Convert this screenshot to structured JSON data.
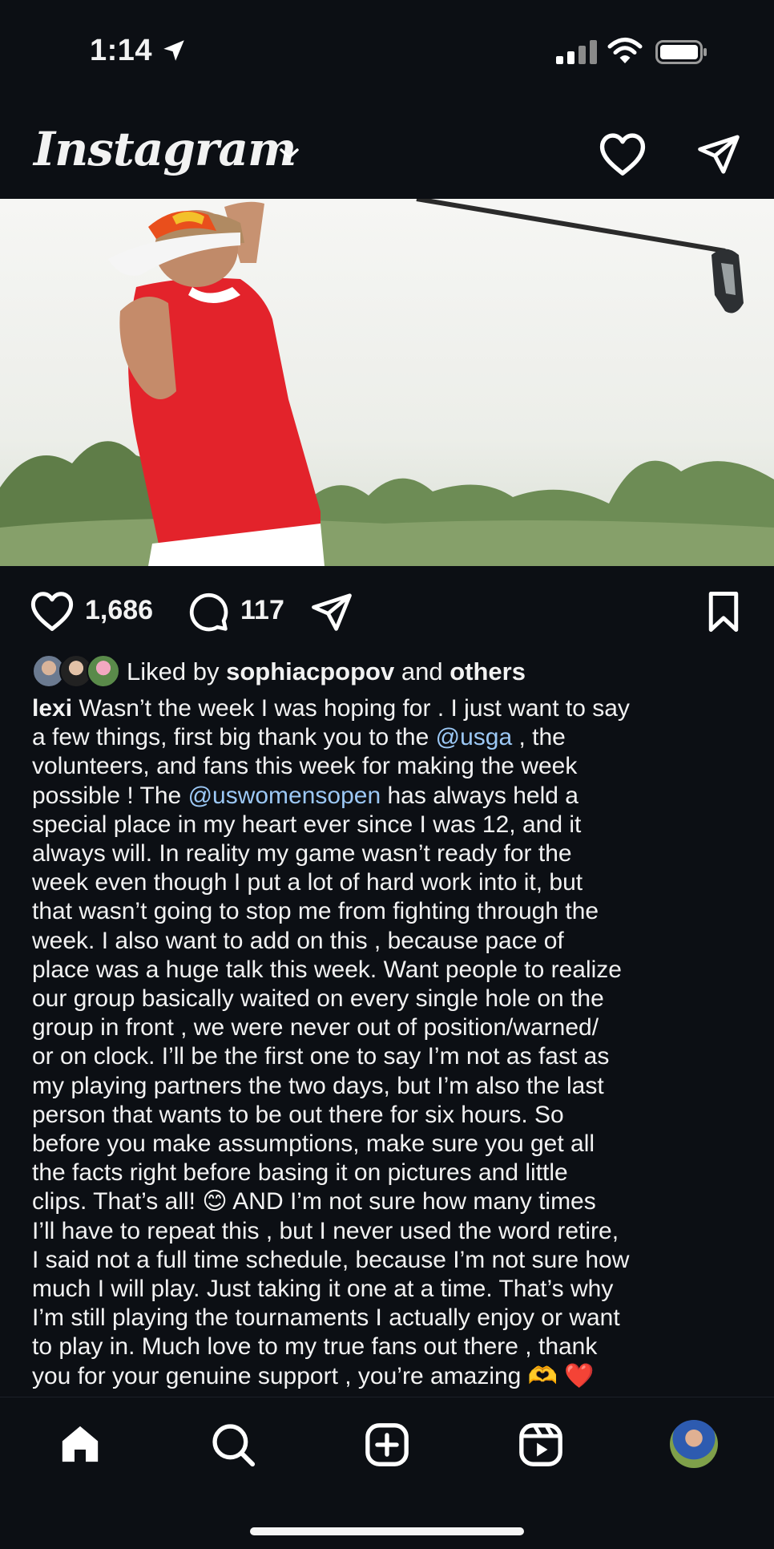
{
  "status_bar": {
    "time": "1:14",
    "icons": [
      "location-arrow-icon",
      "signal-icon",
      "wifi-icon",
      "battery-icon"
    ]
  },
  "header": {
    "logo": "Instagram",
    "icons": [
      "chevron-down-icon",
      "heart-icon",
      "direct-message-icon"
    ]
  },
  "post": {
    "likes": "1,686",
    "comments": "117",
    "liked_by_prefix": "Liked by",
    "liked_by_user": "sophiacpopov",
    "liked_by_and": "and",
    "liked_by_others": "others",
    "caption": {
      "username": "lexi",
      "l1": " Wasn’t the week I was hoping for . I just want to say",
      "l2a": "a few things, first big thank you to the ",
      "m1": "@usga",
      "l2b": " , the",
      "l3": "volunteers, and fans this week for making the week",
      "l4a": "possible ! The ",
      "m2": "@uswomensopen",
      "l4b": " has always held a",
      "l5": "special place in my heart ever since I was 12, and it",
      "l6": "always will. In reality my game wasn’t ready for the",
      "l7": "week even though I put a lot of hard work into it, but",
      "l8": "that wasn’t going to stop me from fighting through the",
      "l9": "week.  I also want to add on this , because pace of",
      "l10": "place was a huge talk this week. Want people to realize",
      "l11": "our group basically waited on every single hole on the",
      "l12": "group in front , we were never out of position/warned/",
      "l13": "or on clock. I’ll be the first one to say I’m not as fast as",
      "l14": "my playing partners the two days, but I’m also the last",
      "l15": "person that wants to be out there for six hours. So",
      "l16": "before you make assumptions, make sure you get all",
      "l17": "the facts right before basing it on pictures and little",
      "l18": "clips.  That’s all! 😊  AND I’m not sure how many times",
      "l19": "I’ll have to repeat this , but I never used the word retire,",
      "l20": "I said not a full time schedule, because I’m not sure how",
      "l21": "much I will play. Just taking it one at a time. That’s why",
      "l22": "I’m still playing the tournaments I actually enjoy or want",
      "l23": "to play in.  Much love to my true fans out there , thank",
      "l24": "you for your genuine support , you’re amazing 🫶 ❤️"
    }
  },
  "bottom_nav": {
    "items": [
      "home-icon",
      "search-icon",
      "create-post-icon",
      "reels-icon",
      "profile-avatar"
    ]
  },
  "colors": {
    "background": "#0c0f14",
    "text": "#f2f2f2",
    "mention": "#9cc8f5",
    "shirt": "#e3232b"
  }
}
